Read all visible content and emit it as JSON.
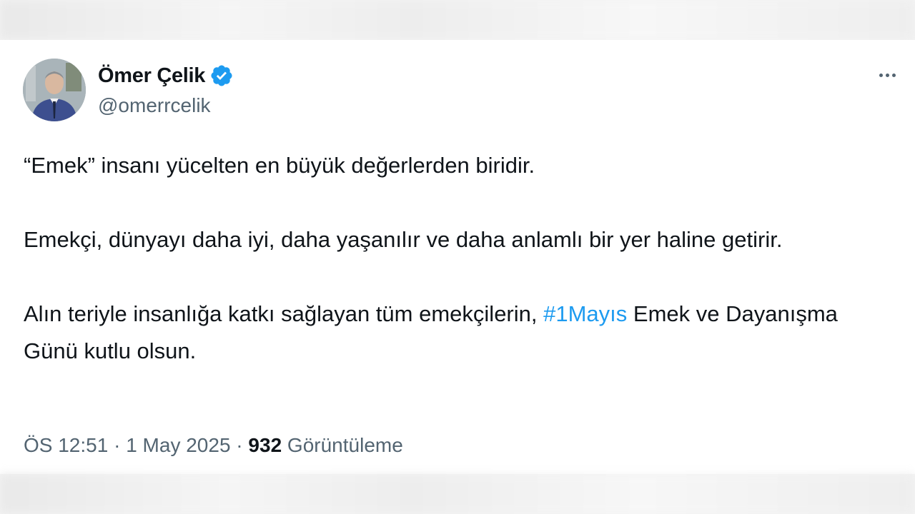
{
  "author": {
    "name": "Ömer Çelik",
    "handle": "@omerrcelik",
    "verified": true,
    "verified_color": "#1d9bf0"
  },
  "tweet": {
    "para1": "“Emek” insanı yücelten en büyük değerlerden biridir.",
    "para2": "Emekçi, dünyayı daha iyi, daha yaşanılır ve daha anlamlı bir yer haline getirir.",
    "para3_before": "Alın teriyle insanlığa katkı sağlayan tüm emekçilerin, ",
    "hashtag": "#1Mayıs",
    "para3_after": " Emek ve Dayanışma Günü kutlu olsun."
  },
  "meta": {
    "time": "ÖS 12:51",
    "sep1": " · ",
    "date": "1 May 2025",
    "sep2": " · ",
    "views_count": "932",
    "views_label": " Görüntüleme"
  },
  "colors": {
    "text": "#0f1419",
    "secondary": "#536471",
    "link": "#1d9bf0"
  },
  "icons": {
    "verified": "verified-badge-icon",
    "more": "more-horizontal-icon"
  }
}
